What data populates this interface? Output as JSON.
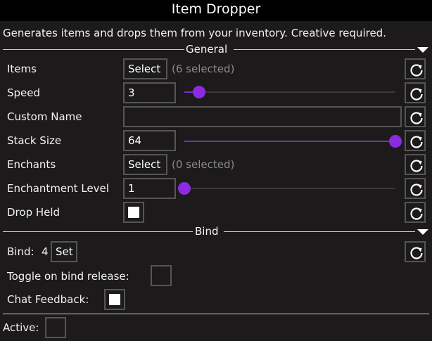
{
  "window": {
    "title": "Item Dropper"
  },
  "description": "Generates items and drops them from your inventory. Creative required.",
  "general": {
    "header": "General",
    "items": {
      "label": "Items",
      "button": "Select",
      "info": "(6 selected)"
    },
    "speed": {
      "label": "Speed",
      "value": "3",
      "slider_fraction": 0.07
    },
    "custom_name": {
      "label": "Custom Name",
      "value": ""
    },
    "stack_size": {
      "label": "Stack Size",
      "value": "64",
      "slider_fraction": 1.0
    },
    "enchants": {
      "label": "Enchants",
      "button": "Select",
      "info": "(0 selected)"
    },
    "enchantment_level": {
      "label": "Enchantment Level",
      "value": "1",
      "slider_fraction": 0.0
    },
    "drop_held": {
      "label": "Drop Held",
      "checked": true
    }
  },
  "bind": {
    "header": "Bind",
    "bind_label": "Bind:",
    "bind_key": "4",
    "set_button": "Set",
    "toggle_release": {
      "label": "Toggle on bind release:",
      "checked": false
    },
    "chat_feedback": {
      "label": "Chat Feedback:",
      "checked": true
    }
  },
  "active": {
    "label": "Active:",
    "checked": false
  },
  "colors": {
    "accent": "#8b2be2",
    "background": "#1c1a1a",
    "titlebar": "#000000"
  }
}
